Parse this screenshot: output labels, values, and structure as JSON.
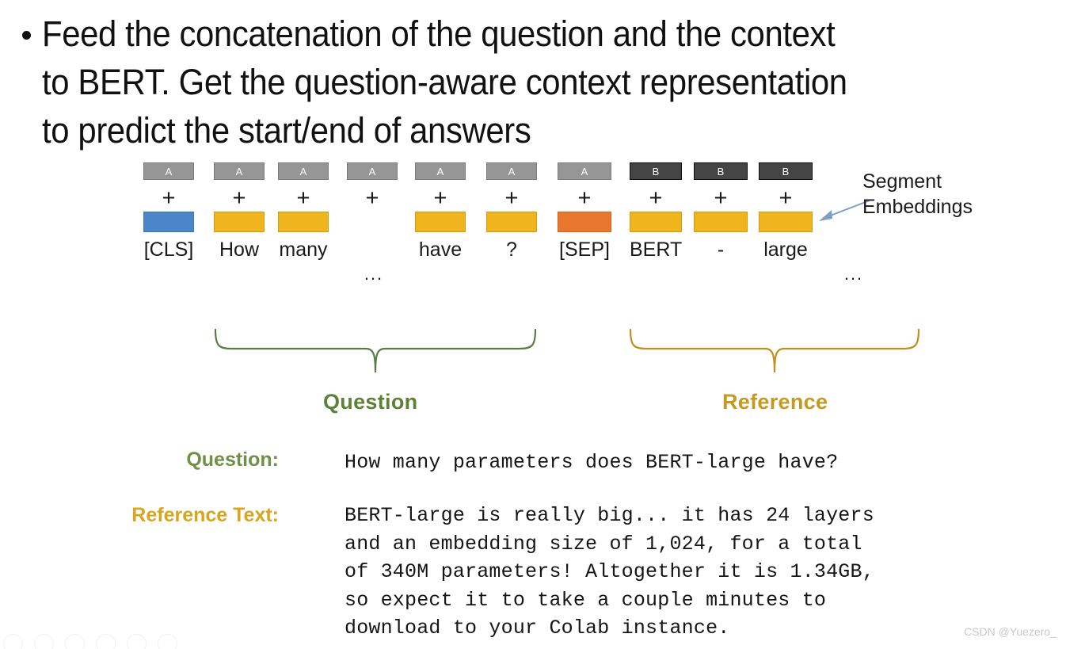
{
  "slide": {
    "bullet_text": "Feed the concatenation of the question and the context\nto BERT. Get the question-aware context representation\nto predict the start/end of answers"
  },
  "colors": {
    "segment_a": "#969696",
    "segment_b": "#454545",
    "token_cls_blue": "#4a86c8",
    "token_word_yellow": "#f0b41e",
    "token_sep_orange": "#e8762c",
    "question_green": "#5b8236",
    "reference_gold": "#c49a22",
    "callout_arrow_blue": "#7da0c8"
  },
  "diagram": {
    "plus_symbol": "+",
    "ellipsis": "...",
    "tokens": [
      {
        "segment": "A",
        "segment_type": "a",
        "token_color": "blue",
        "label": "[CLS]"
      },
      {
        "segment": "A",
        "segment_type": "a",
        "token_color": "yellow",
        "label": "How"
      },
      {
        "segment": "A",
        "segment_type": "a",
        "token_color": "yellow",
        "label": "many"
      },
      {
        "segment": "A",
        "segment_type": "a",
        "token_color": "none",
        "label": ""
      },
      {
        "segment": "A",
        "segment_type": "a",
        "token_color": "yellow",
        "label": "have"
      },
      {
        "segment": "A",
        "segment_type": "a",
        "token_color": "yellow",
        "label": "?"
      },
      {
        "segment": "A",
        "segment_type": "a",
        "token_color": "orange",
        "label": "[SEP]"
      },
      {
        "segment": "B",
        "segment_type": "b",
        "token_color": "yellow",
        "label": "BERT"
      },
      {
        "segment": "B",
        "segment_type": "b",
        "token_color": "yellow",
        "label": "-"
      },
      {
        "segment": "B",
        "segment_type": "b",
        "token_color": "yellow",
        "label": "large"
      }
    ],
    "callout": {
      "label": "Segment\nEmbeddings"
    },
    "groups": [
      {
        "name": "question",
        "label": "Question"
      },
      {
        "name": "reference",
        "label": "Reference"
      }
    ]
  },
  "qa": {
    "question_label": "Question:",
    "question_text": "How many parameters does BERT-large have?",
    "reference_label": "Reference Text:",
    "reference_text": "BERT-large is really big... it has 24 layers\nand an embedding size of 1,024, for a total\nof 340M parameters! Altogether it is 1.34GB,\nso expect it to take a couple minutes to\ndownload to your Colab instance."
  },
  "watermark": {
    "text": "CSDN @Yuezero_"
  }
}
